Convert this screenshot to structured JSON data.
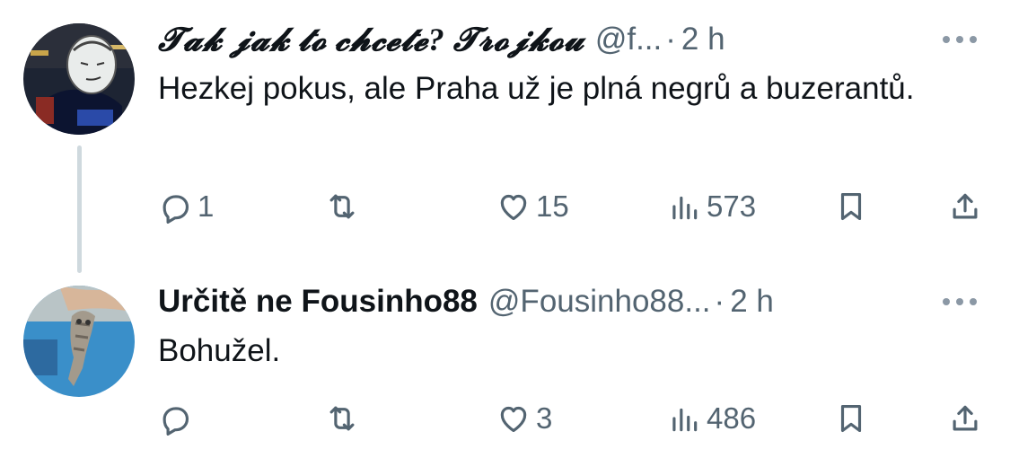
{
  "tweets": [
    {
      "display_name": "𝓣𝓪𝓴 𝓳𝓪𝓴 𝓽𝓸 𝓬𝓱𝓬𝓮𝓽𝓮? 𝓣𝓻𝓸𝓳𝓴𝓸𝓾",
      "handle": "@f...",
      "dot": "·",
      "time": "2 h",
      "text": "Hezkej pokus, ale Praha už je plná negrů a buzerantů.",
      "replies": "1",
      "retweets": "",
      "likes": "15",
      "views": "573"
    },
    {
      "display_name": "Určitě ne Fousinho88",
      "handle": "@Fousinho88...",
      "dot": "·",
      "time": "2 h",
      "text": "Bohužel.",
      "replies": "",
      "retweets": "",
      "likes": "3",
      "views": "486"
    }
  ],
  "icons": {
    "reply": "reply-icon",
    "retweet": "retweet-icon",
    "like": "heart-icon",
    "views": "views-icon",
    "bookmark": "bookmark-icon",
    "share": "share-icon",
    "more": "more-icon"
  },
  "colors": {
    "text": "#0f1419",
    "secondary": "#536471",
    "thread_line": "#cfd9de",
    "background": "#ffffff"
  }
}
